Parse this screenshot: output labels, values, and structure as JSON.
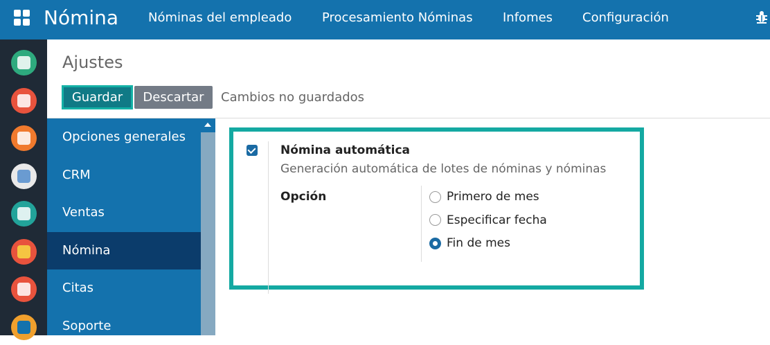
{
  "topbar": {
    "app_title": "Nómina",
    "menu": [
      "Nóminas del empleado",
      "Procesamiento Nóminas",
      "Infomes",
      "Configuración"
    ],
    "icons": [
      "apps-grid-icon",
      "bug-icon"
    ]
  },
  "app_rail": {
    "apps": [
      {
        "name": "discuss-app-icon",
        "color": "#2eaa7e"
      },
      {
        "name": "calendar-app-icon",
        "color": "#e8533d"
      },
      {
        "name": "notes-app-icon",
        "color": "#f07a2d"
      },
      {
        "name": "contacts-app-icon",
        "color": "#e9e9e9"
      },
      {
        "name": "employees-app-icon",
        "color": "#22a39a"
      },
      {
        "name": "crm-app-icon",
        "color": "#e8533d"
      },
      {
        "name": "reports-app-icon",
        "color": "#e8533d"
      },
      {
        "name": "support-app-icon",
        "color": "#f0a02d"
      }
    ]
  },
  "page": {
    "title": "Ajustes",
    "save_label": "Guardar",
    "discard_label": "Descartar",
    "unsaved_text": "Cambios no guardados"
  },
  "settings_nav": {
    "items": [
      {
        "label": "Opciones generales",
        "active": false
      },
      {
        "label": "CRM",
        "active": false
      },
      {
        "label": "Ventas",
        "active": false
      },
      {
        "label": "Nómina",
        "active": true
      },
      {
        "label": "Citas",
        "active": false
      },
      {
        "label": "Soporte",
        "active": false
      }
    ]
  },
  "setting": {
    "checked": true,
    "title": "Nómina automática",
    "description": "Generación automática de lotes de nóminas y nóminas",
    "option_label": "Opción",
    "options": [
      {
        "label": "Primero de mes",
        "selected": false
      },
      {
        "label": "Especificar fecha",
        "selected": false
      },
      {
        "label": "Fin de mes",
        "selected": true
      }
    ]
  },
  "colors": {
    "primary": "#1472ad",
    "nav_active": "#0b3c6b",
    "highlight": "#14a9a2",
    "rail": "#1f2a36"
  }
}
